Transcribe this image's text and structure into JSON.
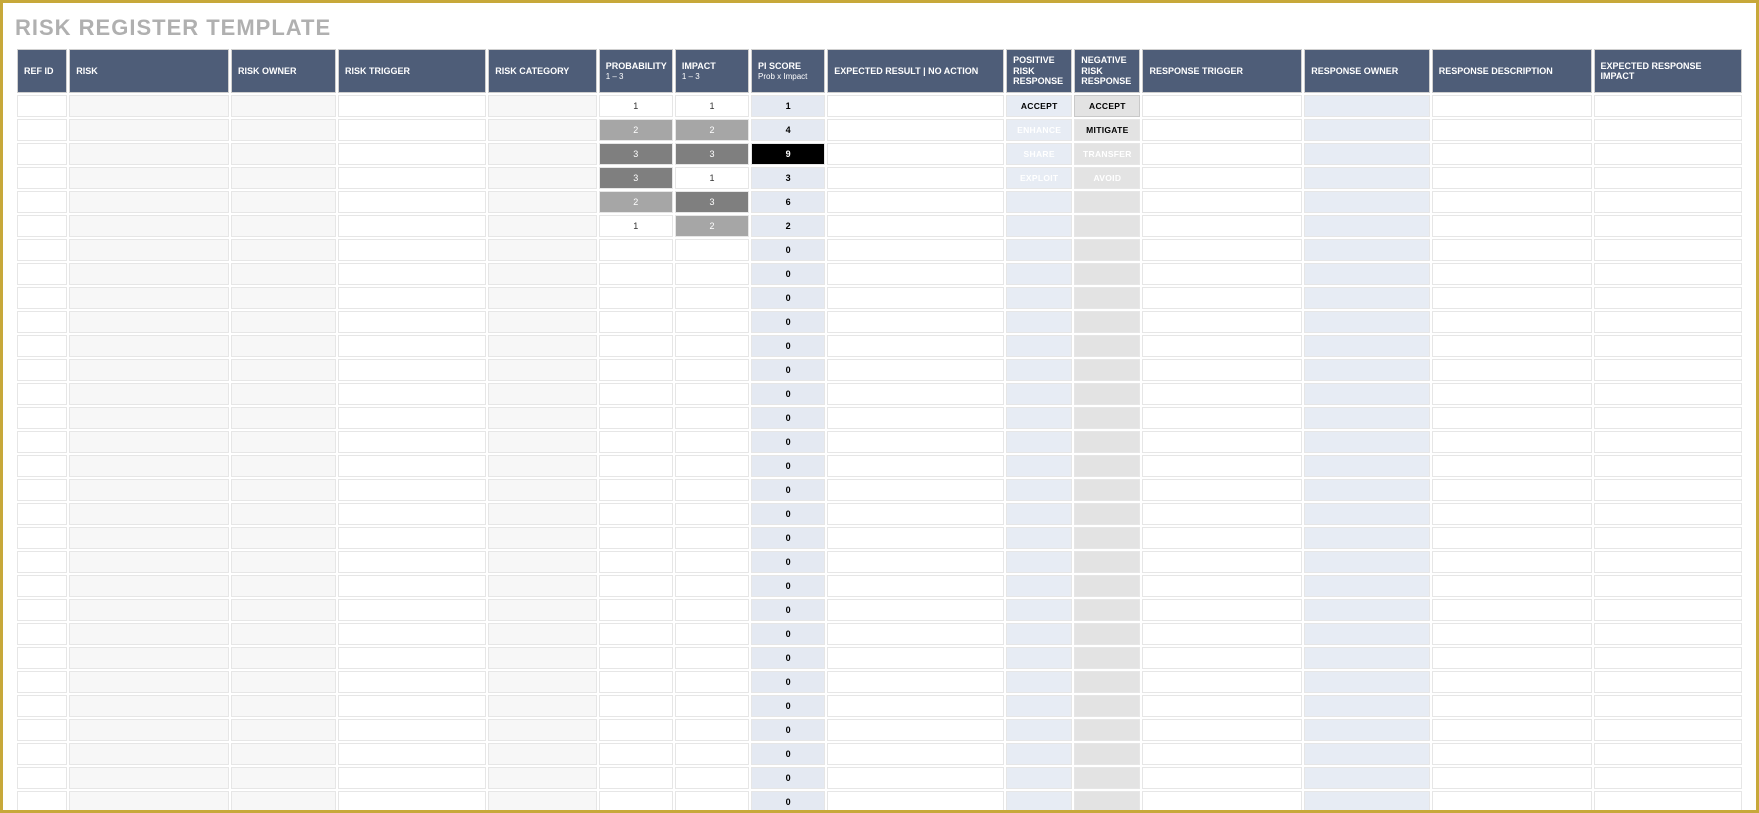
{
  "title": "RISK REGISTER TEMPLATE",
  "headers": {
    "ref": "REF ID",
    "risk": "RISK",
    "owner": "RISK OWNER",
    "trigger": "RISK TRIGGER",
    "category": "RISK CATEGORY",
    "prob": "PROBABILITY",
    "prob_sub": "1 – 3",
    "impact": "IMPACT",
    "impact_sub": "1 – 3",
    "score": "PI SCORE",
    "score_sub": "Prob x Impact",
    "expected": "EXPECTED RESULT | NO ACTION",
    "pos": "POSITIVE RISK RESPONSE",
    "neg": "NEGATIVE RISK RESPONSE",
    "rtrigger": "RESPONSE TRIGGER",
    "rowner": "RESPONSE OWNER",
    "rdesc": "RESPONSE DESCRIPTION",
    "eimpact": "EXPECTED RESPONSE IMPACT"
  },
  "rows": [
    {
      "prob": "1",
      "impact": "1",
      "score": "1",
      "score_dark": false,
      "pos": "ACCEPT",
      "pos_style": "btn-accept-pos",
      "neg": "ACCEPT",
      "neg_style": "btn-accept-neg"
    },
    {
      "prob": "2",
      "impact": "2",
      "score": "4",
      "score_dark": false,
      "pos": "ENHANCE",
      "pos_style": "btn-enhance",
      "neg": "MITIGATE",
      "neg_style": "btn-mitigate"
    },
    {
      "prob": "3",
      "impact": "3",
      "score": "9",
      "score_dark": true,
      "pos": "SHARE",
      "pos_style": "btn-share",
      "neg": "TRANSFER",
      "neg_style": "btn-transfer"
    },
    {
      "prob": "3",
      "impact": "1",
      "score": "3",
      "score_dark": false,
      "pos": "EXPLOIT",
      "pos_style": "btn-exploit",
      "neg": "AVOID",
      "neg_style": "btn-avoid"
    },
    {
      "prob": "2",
      "impact": "3",
      "score": "6",
      "score_dark": false,
      "pos": "",
      "pos_style": "",
      "neg": "",
      "neg_style": ""
    },
    {
      "prob": "1",
      "impact": "2",
      "score": "2",
      "score_dark": false,
      "pos": "",
      "pos_style": "",
      "neg": "",
      "neg_style": ""
    },
    {
      "prob": "",
      "impact": "",
      "score": "0",
      "score_dark": false,
      "pos": "",
      "pos_style": "",
      "neg": "",
      "neg_style": ""
    },
    {
      "prob": "",
      "impact": "",
      "score": "0",
      "score_dark": false,
      "pos": "",
      "pos_style": "",
      "neg": "",
      "neg_style": ""
    },
    {
      "prob": "",
      "impact": "",
      "score": "0",
      "score_dark": false,
      "pos": "",
      "pos_style": "",
      "neg": "",
      "neg_style": ""
    },
    {
      "prob": "",
      "impact": "",
      "score": "0",
      "score_dark": false,
      "pos": "",
      "pos_style": "",
      "neg": "",
      "neg_style": ""
    },
    {
      "prob": "",
      "impact": "",
      "score": "0",
      "score_dark": false,
      "pos": "",
      "pos_style": "",
      "neg": "",
      "neg_style": ""
    },
    {
      "prob": "",
      "impact": "",
      "score": "0",
      "score_dark": false,
      "pos": "",
      "pos_style": "",
      "neg": "",
      "neg_style": ""
    },
    {
      "prob": "",
      "impact": "",
      "score": "0",
      "score_dark": false,
      "pos": "",
      "pos_style": "",
      "neg": "",
      "neg_style": ""
    },
    {
      "prob": "",
      "impact": "",
      "score": "0",
      "score_dark": false,
      "pos": "",
      "pos_style": "",
      "neg": "",
      "neg_style": ""
    },
    {
      "prob": "",
      "impact": "",
      "score": "0",
      "score_dark": false,
      "pos": "",
      "pos_style": "",
      "neg": "",
      "neg_style": ""
    },
    {
      "prob": "",
      "impact": "",
      "score": "0",
      "score_dark": false,
      "pos": "",
      "pos_style": "",
      "neg": "",
      "neg_style": ""
    },
    {
      "prob": "",
      "impact": "",
      "score": "0",
      "score_dark": false,
      "pos": "",
      "pos_style": "",
      "neg": "",
      "neg_style": ""
    },
    {
      "prob": "",
      "impact": "",
      "score": "0",
      "score_dark": false,
      "pos": "",
      "pos_style": "",
      "neg": "",
      "neg_style": ""
    },
    {
      "prob": "",
      "impact": "",
      "score": "0",
      "score_dark": false,
      "pos": "",
      "pos_style": "",
      "neg": "",
      "neg_style": ""
    },
    {
      "prob": "",
      "impact": "",
      "score": "0",
      "score_dark": false,
      "pos": "",
      "pos_style": "",
      "neg": "",
      "neg_style": ""
    },
    {
      "prob": "",
      "impact": "",
      "score": "0",
      "score_dark": false,
      "pos": "",
      "pos_style": "",
      "neg": "",
      "neg_style": ""
    },
    {
      "prob": "",
      "impact": "",
      "score": "0",
      "score_dark": false,
      "pos": "",
      "pos_style": "",
      "neg": "",
      "neg_style": ""
    },
    {
      "prob": "",
      "impact": "",
      "score": "0",
      "score_dark": false,
      "pos": "",
      "pos_style": "",
      "neg": "",
      "neg_style": ""
    },
    {
      "prob": "",
      "impact": "",
      "score": "0",
      "score_dark": false,
      "pos": "",
      "pos_style": "",
      "neg": "",
      "neg_style": ""
    },
    {
      "prob": "",
      "impact": "",
      "score": "0",
      "score_dark": false,
      "pos": "",
      "pos_style": "",
      "neg": "",
      "neg_style": ""
    },
    {
      "prob": "",
      "impact": "",
      "score": "0",
      "score_dark": false,
      "pos": "",
      "pos_style": "",
      "neg": "",
      "neg_style": ""
    },
    {
      "prob": "",
      "impact": "",
      "score": "0",
      "score_dark": false,
      "pos": "",
      "pos_style": "",
      "neg": "",
      "neg_style": ""
    },
    {
      "prob": "",
      "impact": "",
      "score": "0",
      "score_dark": false,
      "pos": "",
      "pos_style": "",
      "neg": "",
      "neg_style": ""
    },
    {
      "prob": "",
      "impact": "",
      "score": "0",
      "score_dark": false,
      "pos": "",
      "pos_style": "",
      "neg": "",
      "neg_style": ""
    },
    {
      "prob": "",
      "impact": "",
      "score": "0",
      "score_dark": false,
      "pos": "",
      "pos_style": "",
      "neg": "",
      "neg_style": ""
    }
  ]
}
